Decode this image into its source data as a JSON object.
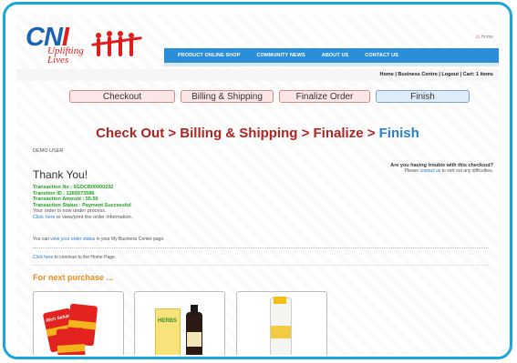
{
  "header": {
    "logo_text_a": "CN",
    "logo_text_b": "I",
    "tagline": "Uplifting Lives",
    "home_label": "Home"
  },
  "nav": {
    "items": [
      "PRODUCT ONLINE SHOP",
      "COMMUNITY NEWS",
      "ABOUT US",
      "CONTACT US"
    ]
  },
  "userbar": {
    "home": "Home",
    "business": "Business Centre",
    "logout": "Logout",
    "cart": "Cart: 1 items"
  },
  "steps": [
    "Checkout",
    "Billing & Shipping",
    "Finalize Order",
    "Finish"
  ],
  "heading": {
    "part1": "Check Out > Billing & Shipping > Finalize >",
    "part2": "Finish"
  },
  "user": "DEMO USER",
  "thanks": "Thank You!",
  "trouble": {
    "title": "Are you having trouble with this checkout?",
    "pre": "Please",
    "link": "contact us",
    "post": "to sort out any difficulties."
  },
  "transaction": {
    "no": "Transaction No : 6GDCB00000202",
    "id": "Transtion ID : 1269373596",
    "amount": "Transaction Amount : 55.50",
    "status": "Transaction Status : Payment Successful",
    "process": "Your order is now under process.",
    "click_link": "Click here",
    "click_text": "to view/print the order information."
  },
  "status_line": {
    "pre": "You can",
    "link": "view your order status",
    "post": "in your My Business Center page."
  },
  "continue_line": {
    "link": "Click here",
    "post": "to continue to the Home Page."
  },
  "next_purchase": "For next purchase ...",
  "products": [
    {
      "label": "Rich Sehati"
    },
    {
      "label": "HERBS"
    },
    {
      "label": ""
    }
  ],
  "colors": {
    "frame": "#1ba6d9",
    "nav": "#2a8ed9",
    "heading_red": "#b42121",
    "heading_blue": "#2a7fc9",
    "success_green": "#1ea51e",
    "orange": "#f08a1c"
  }
}
